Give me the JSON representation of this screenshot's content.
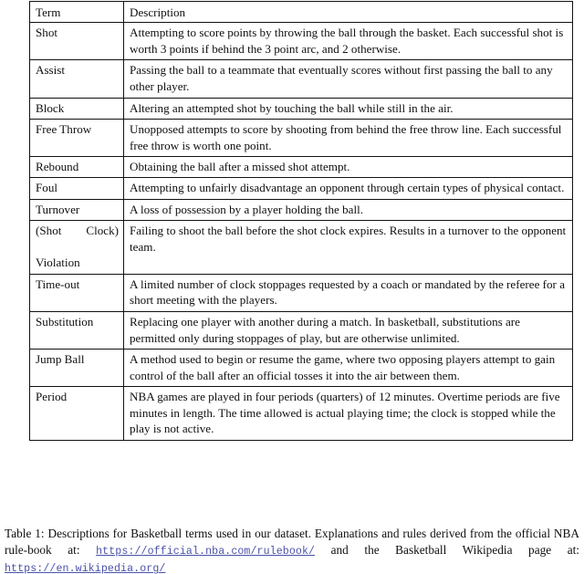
{
  "table": {
    "columns": [
      "Term",
      "Description"
    ],
    "rows": [
      {
        "term": "Shot",
        "description": "Attempting to score points by throwing the ball through the basket. Each successful shot is worth 3 points if behind the 3 point arc, and 2 otherwise."
      },
      {
        "term": "Assist",
        "description": "Passing the ball to a teammate that eventually scores without first passing the ball to any other player."
      },
      {
        "term": "Block",
        "description": "Altering an attempted shot by touching the ball while still in the air."
      },
      {
        "term": "Free Throw",
        "description": "Unopposed attempts to score by shooting from behind the free throw line. Each successful free throw is worth one point."
      },
      {
        "term": "Rebound",
        "description": "Obtaining the ball after a missed shot attempt."
      },
      {
        "term": "Foul",
        "description": "Attempting to unfairly disadvantage an opponent through certain types of physical contact."
      },
      {
        "term": "Turnover",
        "description": "A loss of possession by a player holding the ball."
      },
      {
        "term": "(Shot Clock) Violation",
        "term_line1": "(Shot Clock)",
        "term_line2": "Violation",
        "description": "Failing to shoot the ball before the shot clock expires. Results in a turnover to the opponent team."
      },
      {
        "term": "Time-out",
        "description": "A limited number of clock stoppages requested by a coach or mandated by the referee for a short meeting with the players."
      },
      {
        "term": "Substitution",
        "description": "Replacing one player with another during a match. In basketball, substitutions are permitted only during stoppages of play, but are otherwise unlimited."
      },
      {
        "term": "Jump Ball",
        "description": "A method used to begin or resume the game, where two opposing players attempt to gain control of the ball after an official tosses it into the air between them."
      },
      {
        "term": "Period",
        "description": "NBA games are played in four periods (quarters) of 12 minutes. Overtime periods are five minutes in length. The time allowed is actual playing time; the clock is stopped while the play is not active."
      }
    ]
  },
  "caption": {
    "label": "Table 1:",
    "text_part1": "Descriptions for Basketball terms used in our dataset. Explanations and rules derived from the official NBA rule-book at:",
    "url1": "https://official.nba.com/rulebook/",
    "text_part2": "and the Basketball Wikipedia page at:",
    "url2": "https://en.wikipedia.org/",
    "url_color": "#4a52a8"
  }
}
